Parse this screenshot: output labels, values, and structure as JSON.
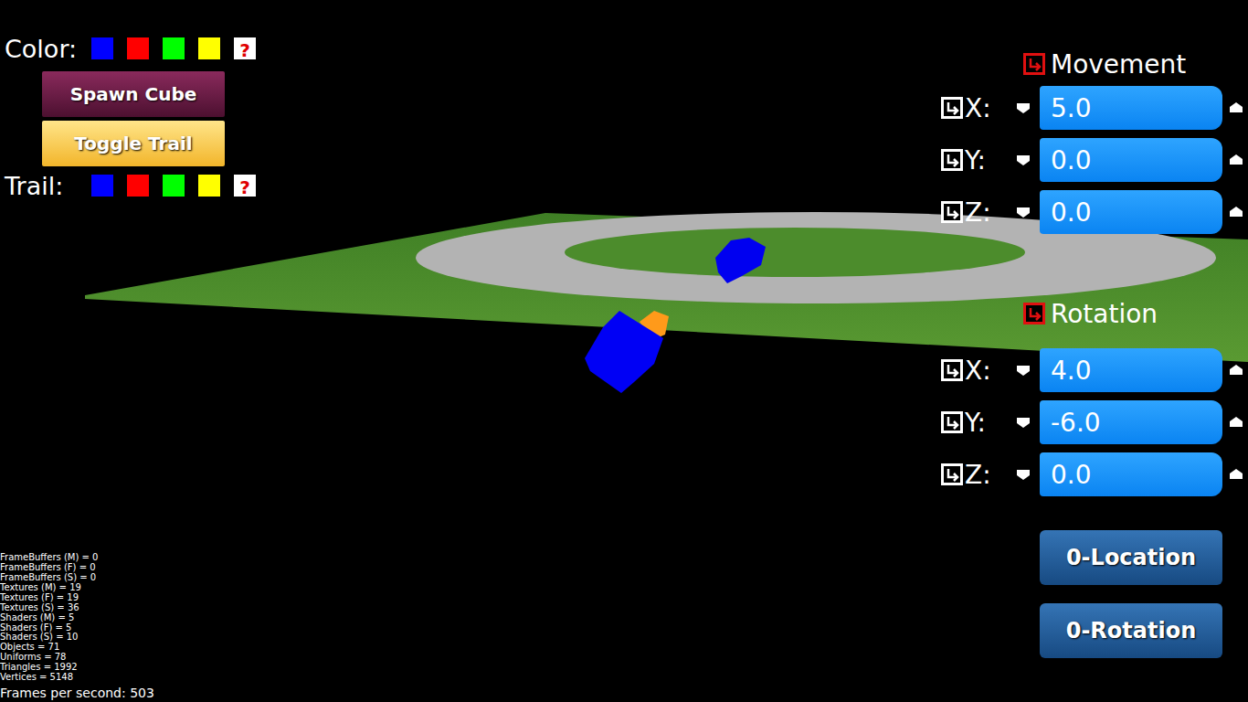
{
  "color_picker": {
    "label": "Color:",
    "swatches": [
      {
        "kind": "solid",
        "color": "#0000ff"
      },
      {
        "kind": "solid",
        "color": "#ff0000"
      },
      {
        "kind": "solid",
        "color": "#00ff00"
      },
      {
        "kind": "solid",
        "color": "#ffff00"
      },
      {
        "kind": "random",
        "label": "?"
      }
    ]
  },
  "buttons": [
    {
      "label": "Spawn Cube"
    },
    {
      "label": "Toggle Trail"
    }
  ],
  "trail_picker": {
    "label": "Trail:",
    "swatches": [
      {
        "kind": "solid",
        "color": "#0000ff"
      },
      {
        "kind": "solid",
        "color": "#ff0000"
      },
      {
        "kind": "solid",
        "color": "#00ff00"
      },
      {
        "kind": "solid",
        "color": "#ffff00"
      },
      {
        "kind": "random",
        "label": "?"
      }
    ]
  },
  "sections": [
    {
      "title": "Movement",
      "expanded": true,
      "rows": [
        {
          "axis": "X:",
          "value": "5.0"
        },
        {
          "axis": "Y:",
          "value": "0.0"
        },
        {
          "axis": "Z:",
          "value": "0.0"
        }
      ]
    },
    {
      "title": "Rotation",
      "expanded": true,
      "rows": [
        {
          "axis": "X:",
          "value": "4.0"
        },
        {
          "axis": "Y:",
          "value": "-6.0"
        },
        {
          "axis": "Z:",
          "value": "0.0"
        }
      ]
    }
  ],
  "reset_buttons": [
    "0-Location",
    "0-Rotation"
  ],
  "stats": [
    "FrameBuffers (M) = 0",
    "FrameBuffers (F) = 0",
    "FrameBuffers (S) = 0",
    "Textures (M) = 19",
    "Textures (F) = 19",
    "Textures (S) = 36",
    "Shaders (M) = 5",
    "Shaders (F) = 5",
    "Shaders (S) = 10",
    "Objects = 71",
    "Uniforms = 78",
    "Triangles = 1992",
    "Vertices = 5148"
  ],
  "fps": "Frames per second: 503"
}
